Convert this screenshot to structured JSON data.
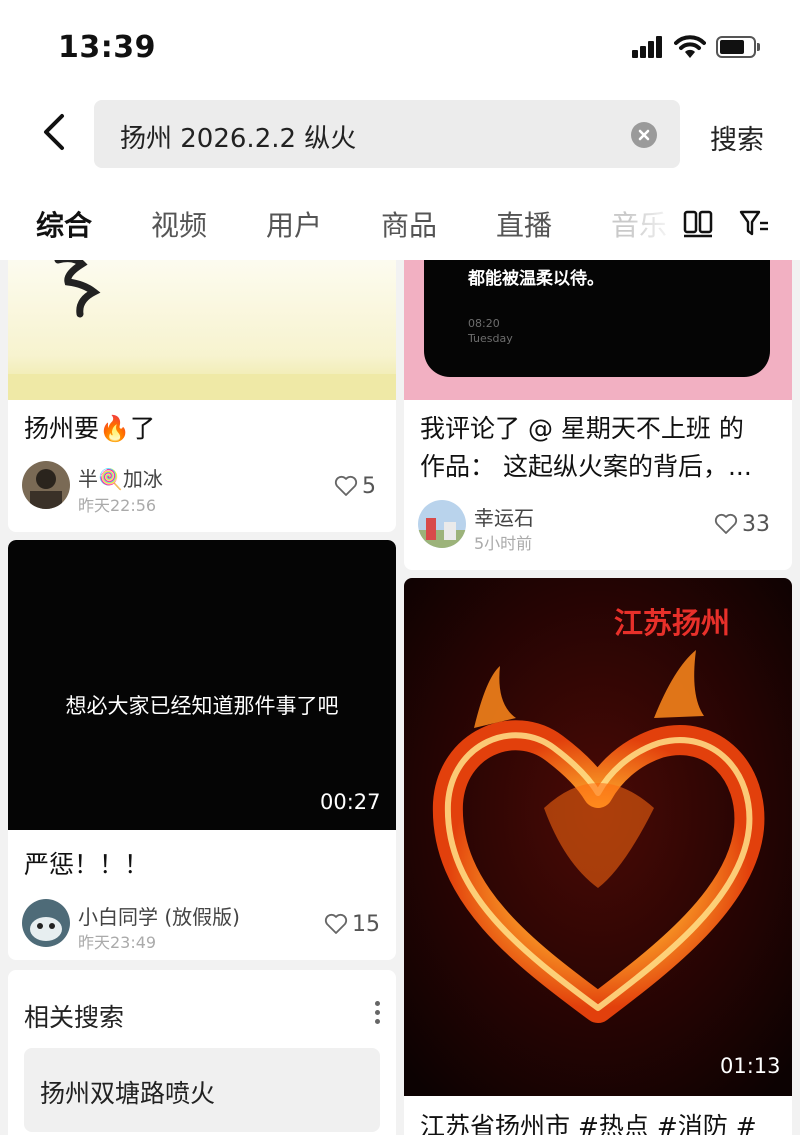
{
  "status": {
    "time": "13:39"
  },
  "search": {
    "query": "扬州 2026.2.2 纵火",
    "button": "搜索"
  },
  "tabs": [
    "综合",
    "视频",
    "用户",
    "商品",
    "直播",
    "音乐"
  ],
  "feed": {
    "card1": {
      "title": "扬州要🔥了",
      "author": "半🍭加冰",
      "time": "昨天22:56",
      "likes": "5"
    },
    "card2": {
      "overlay_text": "都能被温柔以待。",
      "overlay_time": "08:20",
      "overlay_day": "Tuesday",
      "title_line1": "我评论了 @ 星期天不上班 的",
      "title_line2": "作品： 这起纵火案的背后，...",
      "author": "幸运石",
      "time": "5小时前",
      "likes": "33"
    },
    "card3": {
      "overlay_text": "想必大家已经知道那件事了吧",
      "duration": "00:27",
      "title": "严惩！！！",
      "author": "小白同学 (放假版)",
      "time": "昨天23:49",
      "likes": "15"
    },
    "card4": {
      "overlay_text": "江苏扬州",
      "duration": "01:13",
      "title": "江苏省扬州市 #热点 #消防 #"
    },
    "related": {
      "title": "相关搜索",
      "items": [
        "扬州双塘路喷火"
      ]
    }
  }
}
